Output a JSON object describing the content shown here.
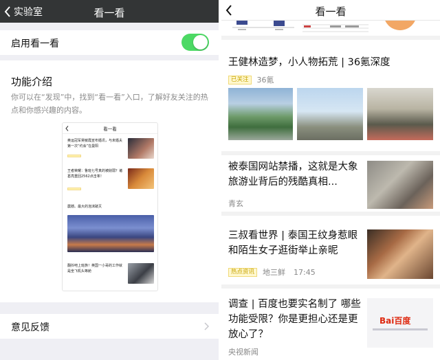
{
  "left": {
    "nav": {
      "back_label": "实验室",
      "title": "看一看"
    },
    "toggle": {
      "label": "启用看一看",
      "enabled": true
    },
    "intro": {
      "heading": "功能介绍",
      "description": "你可以在“发现”中，找到“看一看”入口，了解好友关注的热点和你感兴趣的内容。",
      "mock": {
        "title": "看一看",
        "items": [
          {
            "text": "奥运冠军吴敏霞宣布婚讯，与未婚夫第一次“约会”在曼阳",
            "tag": ""
          },
          {
            "text": "王者荣耀：鲁班七号真的被削弱？诸葛亮重回2562点击率！",
            "tag": ""
          },
          {
            "text": "震撼。最大的泡沫破灭",
            "tag": ""
          },
          {
            "text": "翻抖吧上班族！英国一小哥的工作就是坐飞机头等舱",
            "tag": ""
          }
        ]
      }
    },
    "feedback": {
      "label": "意见反馈"
    }
  },
  "right": {
    "nav": {
      "title": "看一看"
    },
    "articles": [
      {
        "title": "王健林造梦，小人物拓荒 | 36氪深度",
        "tag": "已关注",
        "source": "36氪",
        "time": ""
      },
      {
        "title_line1": "被泰国网站禁播，这就是大象",
        "title_line2": "旅游业背后的残酷真相...",
        "tag": "",
        "source": "青玄",
        "time": ""
      },
      {
        "title_line1": "三叔看世界 | 泰国王纹身惹眼",
        "title_line2": "和陌生女子逛街举止亲昵",
        "tag": "热点资讯",
        "source": "地三鲜",
        "time": "17:45"
      },
      {
        "title_line1": "调查 | 百度也要实名制了 哪些",
        "title_line2": "功能受限？你是更担心还是更",
        "title_line3": "放心了？",
        "tag": "",
        "source": "央视新闻",
        "time": "",
        "thumb_logo": "Bai百度"
      }
    ]
  },
  "colors": {
    "nav_dark": "#333536",
    "switch_on": "#4cd964",
    "tag_yellow": "#c7a300",
    "background": "#efeff4"
  }
}
